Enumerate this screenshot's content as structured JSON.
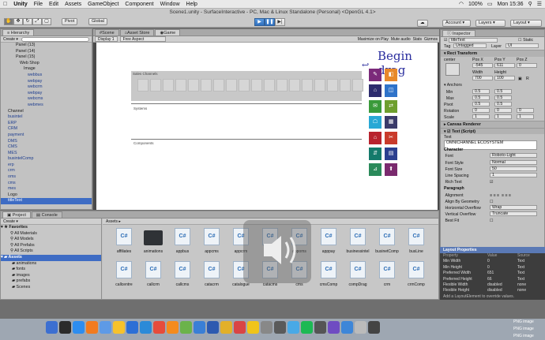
{
  "menubar": {
    "app": "Unity",
    "items": [
      "File",
      "Edit",
      "Assets",
      "GameObject",
      "Component",
      "Window",
      "Help"
    ],
    "battery": "100%",
    "clock": "Mon 15:36"
  },
  "toolbar": {
    "title": "Scene1.unity - SurfaceInteractive - PC, Mac & Linux Standalone (Personal) <OpenGL 4.1>",
    "pivot": "Pivot",
    "global": "Global",
    "account": "Account",
    "layers": "Layers",
    "layout": "Layout"
  },
  "hierarchy": {
    "tab": "Hierarchy",
    "create": "Create",
    "search_placeholder": "All",
    "rows": [
      {
        "label": "Panel (13)",
        "indent": 3,
        "style": ""
      },
      {
        "label": "Panel (14)",
        "indent": 3,
        "style": ""
      },
      {
        "label": "Panel (15)",
        "indent": 3,
        "style": ""
      },
      {
        "label": "Web Shop",
        "indent": 4,
        "style": ""
      },
      {
        "label": "Image",
        "indent": 5,
        "style": ""
      },
      {
        "label": "webbus",
        "indent": 6,
        "style": "blue"
      },
      {
        "label": "webpay",
        "indent": 6,
        "style": "blue"
      },
      {
        "label": "webcrm",
        "indent": 6,
        "style": "blue"
      },
      {
        "label": "webpay",
        "indent": 6,
        "style": "blue"
      },
      {
        "label": "webcms",
        "indent": 6,
        "style": "blue"
      },
      {
        "label": "webmes",
        "indent": 6,
        "style": "blue"
      },
      {
        "label": "Channel",
        "indent": 1,
        "style": ""
      },
      {
        "label": "businteI",
        "indent": 1,
        "style": "blue"
      },
      {
        "label": "ERP",
        "indent": 1,
        "style": "blue"
      },
      {
        "label": "CRM",
        "indent": 1,
        "style": "blue"
      },
      {
        "label": "payment",
        "indent": 1,
        "style": "blue"
      },
      {
        "label": "DMS",
        "indent": 1,
        "style": "blue"
      },
      {
        "label": "CMS",
        "indent": 1,
        "style": "blue"
      },
      {
        "label": "MES",
        "indent": 1,
        "style": "blue"
      },
      {
        "label": "busintelComp",
        "indent": 1,
        "style": "blue"
      },
      {
        "label": "erp",
        "indent": 1,
        "style": "blue"
      },
      {
        "label": "crm",
        "indent": 1,
        "style": "blue"
      },
      {
        "label": "oms",
        "indent": 1,
        "style": "blue"
      },
      {
        "label": "cms",
        "indent": 1,
        "style": "blue"
      },
      {
        "label": "mes",
        "indent": 1,
        "style": "blue"
      },
      {
        "label": "Logo",
        "indent": 1,
        "style": ""
      },
      {
        "label": "titleText",
        "indent": 1,
        "style": "sel"
      }
    ]
  },
  "scene": {
    "tabs": [
      "Scene",
      "Asset Store",
      "Game"
    ],
    "display": "Display 1",
    "aspect": "Free Aspect",
    "maximize": "Maximize on Play",
    "mute": "Mute audio",
    "stats": "Stats",
    "gizmos": "Gizmos"
  },
  "canvas": {
    "top_label": "Sales Channels",
    "mid_label": "Systems",
    "bottom_label": "Components",
    "annotation": "Begin drag",
    "icon_colors": [
      "#7b2a7a",
      "#e8892b",
      "#2d2c6e",
      "#2f73c9",
      "#3a9a3a",
      "#6e9f2e",
      "#29a8d5",
      "#3b3b6a",
      "#b8232e",
      "#c93b2b",
      "#147a6b",
      "#2b3f8f",
      "#2a8a5a",
      "#7a2a6e"
    ],
    "cell_count": 18
  },
  "inspector": {
    "tab": "Inspector",
    "name": "titleText",
    "static": "Static",
    "tag_label": "Tag",
    "tag": "Untagged",
    "layer_label": "Layer",
    "layer": "UI",
    "rect_transform": "Rect Transform",
    "anchor_label": "center",
    "pos_x_label": "Pos X",
    "pos_y_label": "Pos Y",
    "pos_z_label": "Pos Z",
    "pos_x": "-545",
    "pos_y": "611",
    "pos_z": "0",
    "width_label": "Width",
    "height_label": "Height",
    "width": "700",
    "height": "100",
    "anchors": "Anchors",
    "min_label": "Min",
    "max_label": "Max",
    "pivot_label": "Pivot",
    "min_x": "0.5",
    "min_y": "0.5",
    "max_x": "0.5",
    "max_y": "0.5",
    "pivot_x": "0.5",
    "pivot_y": "0.5",
    "rotation_label": "Rotation",
    "rot_x": "0",
    "rot_y": "0",
    "rot_z": "0",
    "scale_label": "Scale",
    "scale_x": "1",
    "scale_y": "1",
    "scale_z": "1",
    "canvas_renderer": "Canvas Renderer",
    "text_script": "Text (Script)",
    "text_label": "Text",
    "text_value": "OMNICHANNEL ECOSYSTEM",
    "character": "Character",
    "font_label": "Font",
    "font": "Roboto-Light",
    "font_style_label": "Font Style",
    "font_style": "Normal",
    "font_size_label": "Font Size",
    "font_size": "50",
    "line_spacing_label": "Line Spacing",
    "line_spacing": "1",
    "rich_text_label": "Rich Text",
    "paragraph": "Paragraph",
    "alignment_label": "Alignment",
    "align_geometry_label": "Align By Geometry",
    "h_overflow_label": "Horizontal Overflow",
    "h_overflow": "Wrap",
    "v_overflow_label": "Vertical Overflow",
    "v_overflow": "Truncate",
    "best_fit_label": "Best Fit"
  },
  "layout_props": {
    "title": "Layout Properties",
    "headers": [
      "Property",
      "Value",
      "Source"
    ],
    "rows": [
      [
        "Min Width",
        "0",
        "Text"
      ],
      [
        "Min Height",
        "0",
        "Text"
      ],
      [
        "Preferred Width",
        "651",
        "Text"
      ],
      [
        "Preferred Height",
        "66",
        "Text"
      ],
      [
        "Flexible Width",
        "disabled",
        "none"
      ],
      [
        "Flexible Height",
        "disabled",
        "none"
      ]
    ],
    "hint": "Add a LayoutElement to override values."
  },
  "project": {
    "tabs": [
      "Project",
      "Console"
    ],
    "create": "Create",
    "favorites": "Favorites",
    "fav_items": [
      "All Materials",
      "All Models",
      "All Prefabs",
      "All Scripts"
    ],
    "assets_root": "Assets",
    "asset_folders": [
      "animations",
      "fonts",
      "images",
      "prefabs",
      "Scenes"
    ],
    "breadcrumb": "Assets",
    "items_row1": [
      "affiliates",
      "animations",
      "appbus",
      "appcms",
      "appcrm",
      "apperp",
      "appoms",
      "apppay",
      "businessintel",
      "businetComp",
      "busLine"
    ],
    "items_row2": [
      "callcentre",
      "callcrm",
      "callcms",
      "catacrm",
      "catalogue",
      "catacms",
      "cms",
      "cmsComp",
      "compDrag",
      "crm",
      "crmComp"
    ]
  },
  "dock": {
    "png1": "PNG image",
    "png2": "PNG image",
    "png3": "PNG image"
  }
}
